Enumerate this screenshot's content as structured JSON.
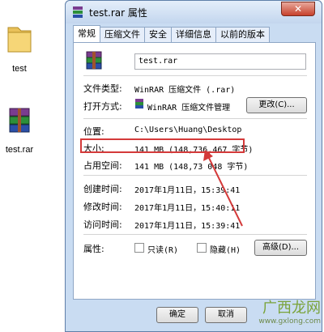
{
  "desktop": {
    "folder_label": "test",
    "rar_label": "test.rar"
  },
  "window": {
    "title": "test.rar 属性",
    "close_glyph": "✕"
  },
  "tabs": [
    "常规",
    "压缩文件",
    "安全",
    "详细信息",
    "以前的版本"
  ],
  "general": {
    "filename": "test.rar",
    "type_label": "文件类型:",
    "type_value": "WinRAR 压缩文件 (.rar)",
    "open_label": "打开方式:",
    "open_value": "WinRAR 压缩文件管理",
    "change_button": "更改(C)...",
    "location_label": "位置:",
    "location_value": "C:\\Users\\Huang\\Desktop",
    "size_label": "大小:",
    "size_value": "141 MB (148,736,467 字节)",
    "disk_label": "占用空间:",
    "disk_value": "141 MB (148,73  048 字节)",
    "created_label": "创建时间:",
    "created_value": "2017年1月11日，15:39:41",
    "modified_label": "修改时间:",
    "modified_value": "2017年1月11日，15:40:11",
    "accessed_label": "访问时间:",
    "accessed_value": "2017年1月11日，15:39:41",
    "attributes_label": "属性:",
    "readonly_label": "只读(R)",
    "hidden_label": "隐藏(H)",
    "advanced_button": "高级(D)..."
  },
  "buttons": {
    "ok": "确定",
    "cancel": "取消"
  },
  "watermark": {
    "text": "广西龙网",
    "subtext": "www.gxlong.com"
  },
  "colors": {
    "highlight": "#d43a3a",
    "title_bar": "#c9dcf2"
  }
}
